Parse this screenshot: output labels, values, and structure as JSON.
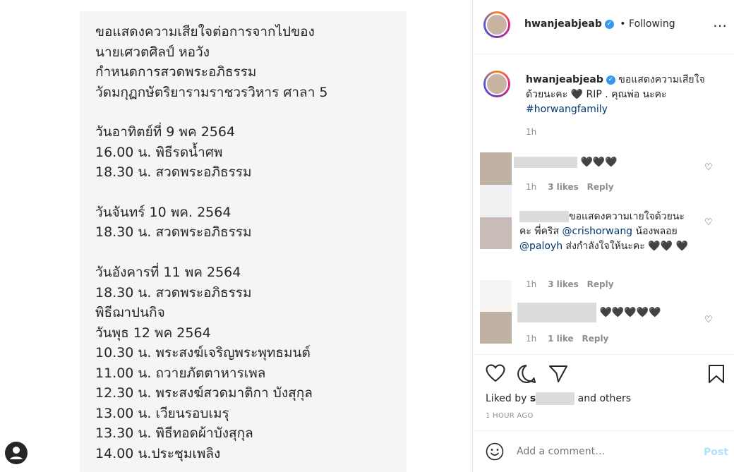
{
  "post": {
    "lines": [
      "ขอแสดงความเสียใจต่อการจากไปของ",
      "นายเศวตศิลป์ หอวัง",
      "กำหนดการสวดพระอภิธรรม",
      "วัดมกุฏกษัตริยารามราชวรวิหาร ศาลา 5",
      "วันอาทิตย์ที่ 9 พค 2564",
      "16.00 น. พิธีรดน้ำศพ",
      "18.30 น. สวดพระอภิธรรม",
      "วันจันทร์ 10 พค. 2564",
      "18.30 น. สวดพระอภิธรรม",
      "วันอังคารที่ 11 พค 2564",
      "18.30 น. สวดพระอภิธรรม",
      "พิธีฌาปนกิจ",
      "วันพุธ 12 พค 2564",
      "10.30 น. พระสงฆ์เจริญพระพุทธมนต์",
      "11.00 น. ถวายภัตตาหารเพล",
      "12.30 น. พระสงฆ์สวดมาติกา บังสุกุล",
      "13.00 น. เวียนรอบเมรุ",
      "13.30 น. พิธีทอดผ้าบังสุกุล",
      "14.00 น.ประชุมเพลิง"
    ]
  },
  "header": {
    "username": "hwanjeabjeab",
    "separator": "•",
    "follow_status": "Following",
    "more_icon": "more-horizontal-icon"
  },
  "caption": {
    "username": "hwanjeabjeab",
    "text_1": "ขอแสดงความเสียใจ",
    "text_2": "ด้วยนะคะ",
    "text_3": "RIP . คุณพ่อ นะคะ",
    "hashtag": "#horwangfamily",
    "time": "1h"
  },
  "comments": [
    {
      "hearts": "🖤🖤🖤",
      "time": "1h",
      "likes": "3 likes",
      "reply": "Reply"
    },
    {
      "text_1": "ขอแสดงความเายใจด้วยนะ",
      "text_2": "คะ พี่คริส",
      "mention_1": "@crishorwang",
      "text_3": "น้องพลอย",
      "mention_2": "@paloyh",
      "text_4": "ส่งกำลังใจให้นะคะ",
      "hearts": "🖤🖤",
      "hearts_2": "🖤",
      "time": "1h",
      "likes": "3 likes",
      "reply": "Reply"
    },
    {
      "hearts": "🖤🖤🖤🖤🖤",
      "time": "1h",
      "likes": "1 like",
      "reply": "Reply"
    }
  ],
  "actions": {
    "liked_by_prefix": "Liked by",
    "liked_by_user_start": "s",
    "liked_by_suffix": "and others",
    "time_ago": "1 HOUR AGO"
  },
  "composer": {
    "placeholder": "Add a comment…",
    "post_label": "Post"
  },
  "colors": {
    "accent": "#3897f0",
    "post_disabled": "#b2dffc",
    "text": "#262626",
    "muted": "#8e8e8e"
  }
}
